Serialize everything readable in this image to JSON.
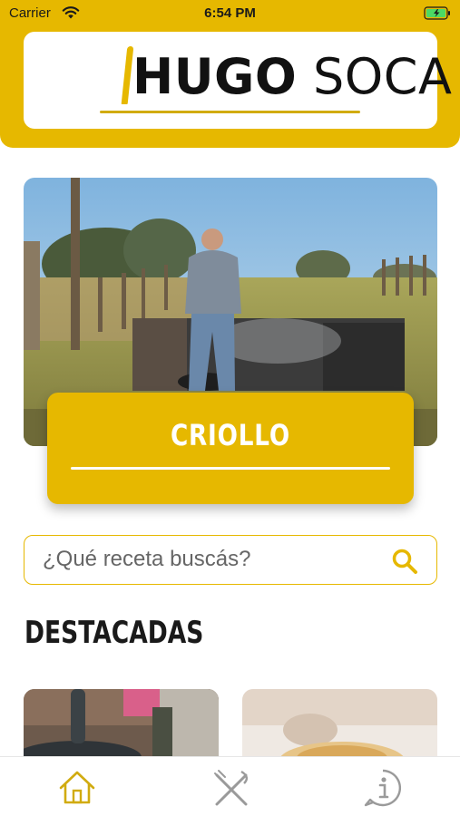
{
  "status_bar": {
    "carrier": "Carrier",
    "time": "6:54 PM"
  },
  "brand": {
    "logo_bold": "HUGO",
    "logo_regular": "SOCA",
    "accent_color": "#e6b800"
  },
  "featured_category": {
    "title": "CRIOLLO"
  },
  "search": {
    "placeholder": "¿Qué receta buscás?"
  },
  "sections": {
    "highlighted_title": "DESTACADAS"
  },
  "tabbar": {
    "items": [
      {
        "icon": "home-icon",
        "active": true
      },
      {
        "icon": "fork-knife-icon",
        "active": false
      },
      {
        "icon": "info-icon",
        "active": false
      }
    ]
  }
}
